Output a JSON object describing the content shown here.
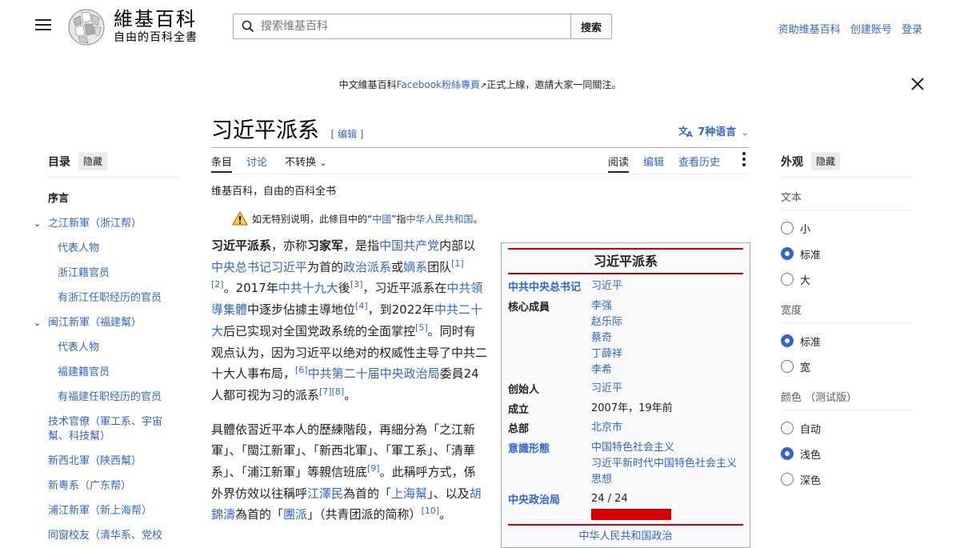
{
  "header": {
    "site_name": "維基百科",
    "site_tagline": "自由的百科全書",
    "search_placeholder": "搜索维基百科",
    "search_button": "搜索",
    "user_links": [
      "资助维基百科",
      "创建账号",
      "登录"
    ]
  },
  "banner": {
    "prefix": "中文維基百科",
    "link": "Facebook粉絲專頁",
    "suffix": "正式上線，邀請大家一同關注。"
  },
  "toc": {
    "title": "目录",
    "hide": "隐藏",
    "items": [
      {
        "label": "序言",
        "level": 1,
        "current": true
      },
      {
        "label": "之江新軍（浙江帮）",
        "level": 1,
        "expandable": true
      },
      {
        "label": "代表人物",
        "level": 2
      },
      {
        "label": "浙江籍官员",
        "level": 2
      },
      {
        "label": "有浙江任职经历的官员",
        "level": 2
      },
      {
        "label": "闽江新軍（福建幫）",
        "level": 1,
        "expandable": true
      },
      {
        "label": "代表人物",
        "level": 2
      },
      {
        "label": "福建籍官员",
        "level": 2
      },
      {
        "label": "有福建任职经历的官员",
        "level": 2
      },
      {
        "label": "技术官僚（軍工系、宇宙幫、科技幫）",
        "level": 1
      },
      {
        "label": "新西北軍（陕西幫）",
        "level": 1
      },
      {
        "label": "新粵系（广东帮）",
        "level": 1
      },
      {
        "label": "浦江新軍（新上海帮）",
        "level": 1
      },
      {
        "label": "同窗校友（清华系、党校",
        "level": 1
      }
    ]
  },
  "article": {
    "title": "习近平派系",
    "edit": "编辑",
    "languages": "7种语言",
    "tabs_left": [
      "条目",
      "讨论",
      "不转换"
    ],
    "tabs_right": [
      "阅读",
      "编辑",
      "查看历史"
    ],
    "tagline": "维基百科，自由的百科全书",
    "hatnote": {
      "a": "如无特别说明，此條目中的“",
      "b": "中國",
      "c": "”指",
      "d": "中华人民共和国",
      "e": "。"
    }
  },
  "infobox": {
    "title": "习近平派系",
    "rows": [
      {
        "label": "中共中央总书记",
        "values": [
          "习近平"
        ]
      },
      {
        "label": "核心成員",
        "values": [
          "李强",
          "赵乐际",
          "蔡奇",
          "丁薛祥",
          "李希"
        ]
      },
      {
        "label": "创始人",
        "values": [
          "习近平"
        ]
      },
      {
        "label": "成立",
        "values": [
          "2007年，19年前"
        ]
      },
      {
        "label": "总部",
        "values": [
          "北京市"
        ]
      },
      {
        "label": "意識形態",
        "values": [
          "中国特色社会主义",
          "习近平新时代中国特色社会主义思想"
        ]
      },
      {
        "label": "中央政治局",
        "values": [
          "24 / 24"
        ],
        "fill_fraction": 1.0
      }
    ],
    "footer": "中华人民共和国政治"
  },
  "appearance": {
    "title": "外观",
    "hide": "隐藏",
    "sections": [
      {
        "label": "文本",
        "options": [
          "小",
          "标准",
          "大"
        ],
        "selected": 1
      },
      {
        "label": "宽度",
        "options": [
          "标准",
          "宽"
        ],
        "selected": 0
      },
      {
        "label": "颜色 （测试版）",
        "options": [
          "自动",
          "浅色",
          "深色"
        ],
        "selected": 1
      }
    ]
  },
  "colors": {
    "link": "#3366cc",
    "accent_red": "#d40000",
    "text": "#202122"
  }
}
